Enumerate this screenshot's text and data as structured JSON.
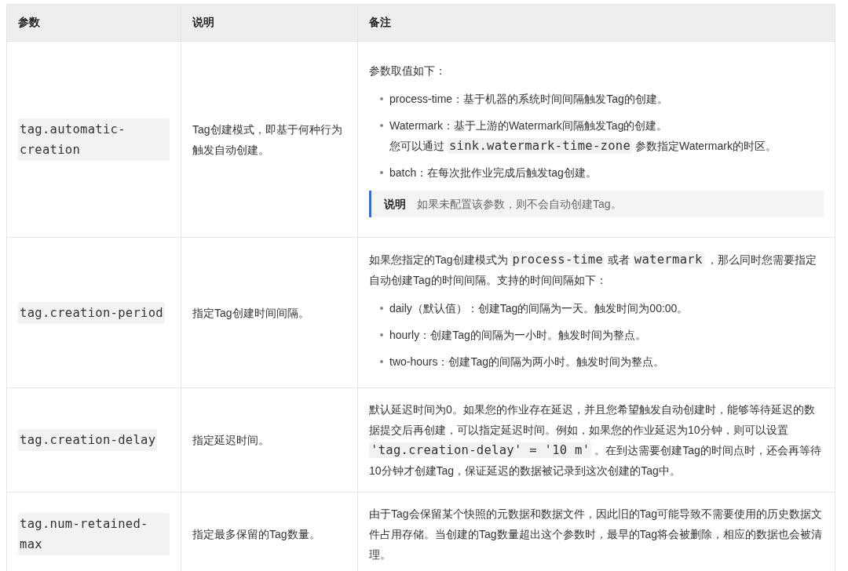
{
  "table": {
    "columns": [
      "参数",
      "说明",
      "备注"
    ],
    "rows": [
      {
        "parameter": "tag.automatic-creation",
        "description": "Tag创建模式，即基于何种行为触发自动创建。",
        "notes": [
          {
            "kind": "paragraph",
            "segments": [
              {
                "kind": "text",
                "text": "参数取值如下："
              }
            ]
          },
          {
            "kind": "list",
            "items": [
              {
                "lines": [
                  [
                    {
                      "kind": "text",
                      "text": "process-time：基于机器的系统时间间隔触发Tag的创建。"
                    }
                  ]
                ]
              },
              {
                "lines": [
                  [
                    {
                      "kind": "text",
                      "text": "Watermark：基于上游的Watermark间隔触发Tag的创建。"
                    }
                  ],
                  [
                    {
                      "kind": "text",
                      "text": "您可以通过 "
                    },
                    {
                      "kind": "code",
                      "text": "sink.watermark-time-zone"
                    },
                    {
                      "kind": "text",
                      "text": " 参数指定Watermark的时区。"
                    }
                  ]
                ]
              },
              {
                "lines": [
                  [
                    {
                      "kind": "text",
                      "text": "batch：在每次批作业完成后触发tag创建。"
                    }
                  ]
                ]
              }
            ]
          },
          {
            "kind": "note",
            "label": "说明",
            "text": "如果未配置该参数，则不会自动创建Tag。"
          }
        ]
      },
      {
        "parameter": "tag.creation-period",
        "description": "指定Tag创建时间间隔。",
        "notes": [
          {
            "kind": "paragraph",
            "segments": [
              {
                "kind": "text",
                "text": "如果您指定的Tag创建模式为 "
              },
              {
                "kind": "code",
                "text": "process-time"
              },
              {
                "kind": "text",
                "text": " 或者 "
              },
              {
                "kind": "code",
                "text": "watermark"
              },
              {
                "kind": "text",
                "text": " ，那么同时您需要指定自动创建Tag的时间间隔。支持的时间间隔如下："
              }
            ]
          },
          {
            "kind": "list",
            "items": [
              {
                "lines": [
                  [
                    {
                      "kind": "text",
                      "text": "daily（默认值）：创建Tag的间隔为一天。触发时间为00:00。"
                    }
                  ]
                ]
              },
              {
                "lines": [
                  [
                    {
                      "kind": "text",
                      "text": "hourly：创建Tag的间隔为一小时。触发时间为整点。"
                    }
                  ]
                ]
              },
              {
                "lines": [
                  [
                    {
                      "kind": "text",
                      "text": "two-hours：创建Tag的间隔为两小时。触发时间为整点。"
                    }
                  ]
                ]
              }
            ]
          }
        ]
      },
      {
        "parameter": "tag.creation-delay",
        "description": "指定延迟时间。",
        "notes": [
          {
            "kind": "paragraph",
            "segments": [
              {
                "kind": "text",
                "text": "默认延迟时间为0。如果您的作业存在延迟，并且您希望触发自动创建时，能够等待延迟的数据提交后再创建，可以指定延迟时间。例如，如果您的作业延迟为10分钟，则可以设置 "
              },
              {
                "kind": "code",
                "text": "'tag.creation-delay' = '10 m'"
              },
              {
                "kind": "text",
                "text": " 。在到达需要创建Tag的时间点时，还会再等待10分钟才创建Tag，保证延迟的数据被记录到这次创建的Tag中。"
              }
            ]
          }
        ]
      },
      {
        "parameter": "tag.num-retained-max",
        "description": "指定最多保留的Tag数量。",
        "notes": [
          {
            "kind": "paragraph",
            "segments": [
              {
                "kind": "text",
                "text": "由于Tag会保留某个快照的元数据和数据文件，因此旧的Tag可能导致不需要使用的历史数据文件占用存储。当创建的Tag数量超出这个参数时，最早的Tag将会被删除，相应的数据也会被清理。"
              }
            ]
          }
        ]
      }
    ]
  }
}
